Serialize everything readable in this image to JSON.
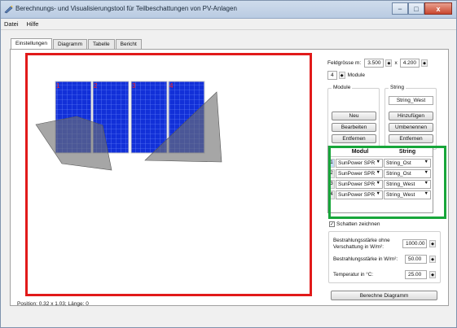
{
  "window": {
    "title": "Berechnungs- und Visualisierungstool für Teilbeschattungen von PV-Anlagen",
    "minimize": "−",
    "maximize": "□",
    "close": "x"
  },
  "menu": {
    "items": [
      "Datei",
      "Hilfe"
    ]
  },
  "tabs": [
    "Einstellungen",
    "Diagramm",
    "Tabelle",
    "Bericht"
  ],
  "canvas": {
    "module_labels": [
      "1",
      "2",
      "3",
      "4"
    ],
    "colors": {
      "module": "#1230d8",
      "grid": "#6f8fff",
      "shadow": "#707070",
      "label": "#ff2020",
      "highlight": "#e11a1a"
    }
  },
  "status": "Position: 0.32 x 1.03;  Länge: 0",
  "feld": {
    "label": "Feldgrösse m:",
    "width": "3.500",
    "times": "x",
    "height": "4.200",
    "module_count": "4",
    "module_label": "Module"
  },
  "module_group": {
    "title": "Module",
    "buttons": [
      "Neu",
      "Bearbeiten",
      "Entfernen"
    ]
  },
  "string_group": {
    "title": "String",
    "value": "String_West",
    "buttons": [
      "Hinzufügen",
      "Umbenennen",
      "Entfernen"
    ]
  },
  "table": {
    "headers": [
      "Modul",
      "String"
    ],
    "rows": [
      {
        "num": "1",
        "modul": "SunPower SPR",
        "string": "String_Ost"
      },
      {
        "num": "2",
        "modul": "SunPower SPR",
        "string": "String_Ost"
      },
      {
        "num": "3",
        "modul": "SunPower SPR",
        "string": "String_West"
      },
      {
        "num": "4",
        "modul": "SunPower SPR",
        "string": "String_West"
      }
    ],
    "highlight_color": "#17a63a"
  },
  "schatten": {
    "label": "Schatten zeichnen",
    "checked": "✓"
  },
  "params": {
    "irradiance_no_shade_label": "Bestrahlungsstärke ohne Verschattung in W/m²:",
    "irradiance_no_shade": "1000.00",
    "irradiance_label": "Bestrahlungsstärke in W/m²:",
    "irradiance": "50.00",
    "temperature_label": "Temperatur in °C:",
    "temperature": "25.00"
  },
  "calc_button": "Berechne Diagramm"
}
